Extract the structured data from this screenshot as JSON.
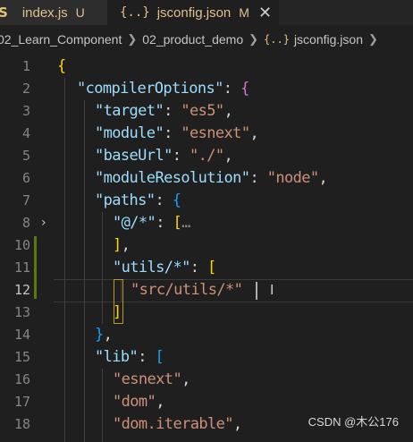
{
  "tabs": [
    {
      "icon": "JS",
      "name": "index.js",
      "status": "U"
    },
    {
      "icon": "{..}",
      "name": "jsconfig.json",
      "status": "M"
    }
  ],
  "breadcrumb": {
    "items": [
      "02_Learn_Component",
      "02_product_demo",
      "jsconfig.json"
    ],
    "file_icon": "{..}"
  },
  "editor": {
    "lines": [
      {
        "n": "1"
      },
      {
        "n": "2"
      },
      {
        "n": "3"
      },
      {
        "n": "4"
      },
      {
        "n": "5"
      },
      {
        "n": "6"
      },
      {
        "n": "7"
      },
      {
        "n": "8"
      },
      {
        "n": "10"
      },
      {
        "n": "11"
      },
      {
        "n": "12"
      },
      {
        "n": "13"
      },
      {
        "n": "14"
      },
      {
        "n": "15"
      },
      {
        "n": "16"
      },
      {
        "n": "17"
      },
      {
        "n": "18"
      }
    ],
    "active_line": "12",
    "folded_line": "8",
    "code": {
      "compilerOptions": "\"compilerOptions\"",
      "target_key": "\"target\"",
      "target_val": "\"es5\"",
      "module_key": "\"module\"",
      "module_val": "\"esnext\"",
      "baseUrl_key": "\"baseUrl\"",
      "baseUrl_val": "\"./\"",
      "moduleResolution_key": "\"moduleResolution\"",
      "moduleResolution_val": "\"node\"",
      "paths_key": "\"paths\"",
      "alias_key": "\"@/*\"",
      "ellipsis": "…",
      "utils_key": "\"utils/*\"",
      "utils_val": "\"src/utils/*\"",
      "lib_key": "\"lib\"",
      "lib_1": "\"esnext\"",
      "lib_2": "\"dom\"",
      "lib_3": "\"dom.iterable\""
    }
  },
  "watermark": "CSDN @木公176",
  "colors": {
    "background": "#1f1f1f",
    "property": "#9cdcfe",
    "string": "#ce9178",
    "bracket_level1": "#ffd700",
    "bracket_level2": "#da70d6",
    "bracket_level3": "#179fff",
    "git_modified": "#587c0c",
    "tab_modified": "#e2c08d"
  },
  "icons": {
    "close": "close-icon",
    "fold": "chevron-right-icon",
    "json": "json-file-icon",
    "js": "js-file-icon"
  }
}
